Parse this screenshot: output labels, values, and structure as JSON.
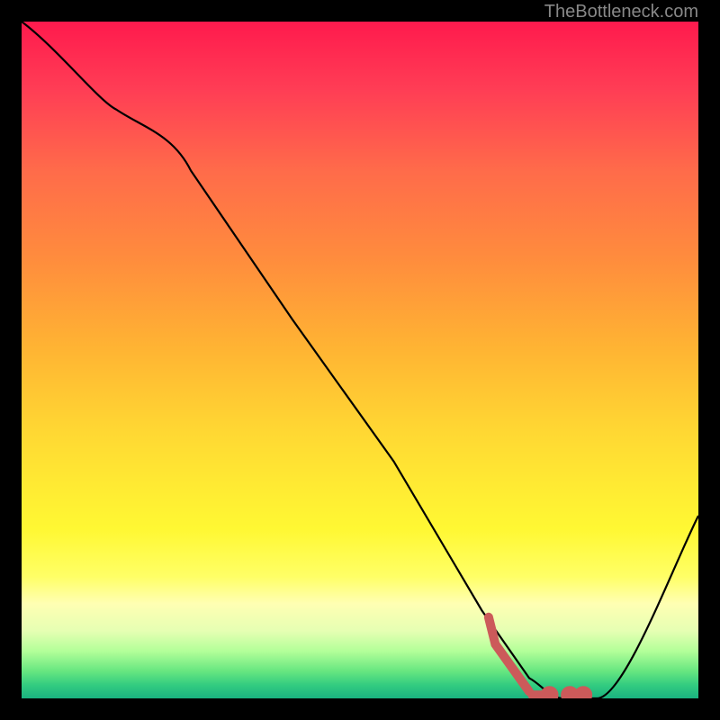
{
  "watermark": "TheBottleneck.com",
  "chart_data": {
    "type": "line",
    "title": "",
    "xlabel": "",
    "ylabel": "",
    "xlim": [
      0,
      100
    ],
    "ylim": [
      0,
      100
    ],
    "series": [
      {
        "name": "bottleneck-curve",
        "x": [
          0,
          14,
          25,
          40,
          55,
          68,
          75,
          80,
          85,
          100
        ],
        "y": [
          100,
          87,
          78,
          56,
          35,
          13,
          3,
          0,
          0,
          27
        ],
        "color": "#000000",
        "style": "solid"
      },
      {
        "name": "optimal-dotted",
        "x": [
          69,
          70,
          75,
          78,
          81,
          83
        ],
        "y": [
          12,
          8,
          1,
          0.5,
          0.5,
          0.5
        ],
        "color": "#cc5a5a",
        "style": "dotted"
      }
    ],
    "gradient_colors": {
      "top": "#ff1a4d",
      "mid": "#ffd633",
      "bottom": "#1ab380"
    }
  }
}
